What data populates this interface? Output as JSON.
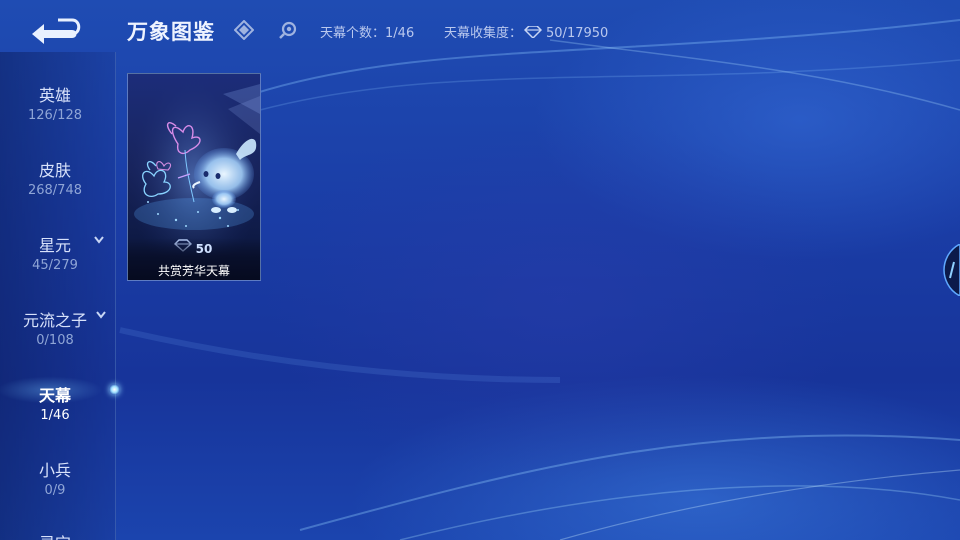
{
  "header": {
    "title": "万象图鉴",
    "stat_count_label": "天幕个数：",
    "stat_count_value": "1/46",
    "stat_collect_label": "天幕收集度：",
    "stat_collect_value": "50/17950"
  },
  "sidebar": {
    "items": [
      {
        "label": "英雄",
        "count": "126/128"
      },
      {
        "label": "皮肤",
        "count": "268/748"
      },
      {
        "label": "星元",
        "count": "45/279"
      },
      {
        "label": "元流之子",
        "count": "0/108"
      },
      {
        "label": "天幕",
        "count": "1/46"
      },
      {
        "label": "小兵",
        "count": "0/9"
      },
      {
        "label": "灵宝",
        "count": ""
      }
    ],
    "active_label": "天幕"
  },
  "cards": [
    {
      "price": "50",
      "name": "共赏芳华天幕"
    }
  ],
  "colors": {
    "accent": "#8fd4ff",
    "background": "#1a3da6"
  },
  "icons": [
    "back-arrow-icon",
    "diamond-filter-icon",
    "search-icon",
    "gem-icon",
    "chevron-down-icon"
  ]
}
